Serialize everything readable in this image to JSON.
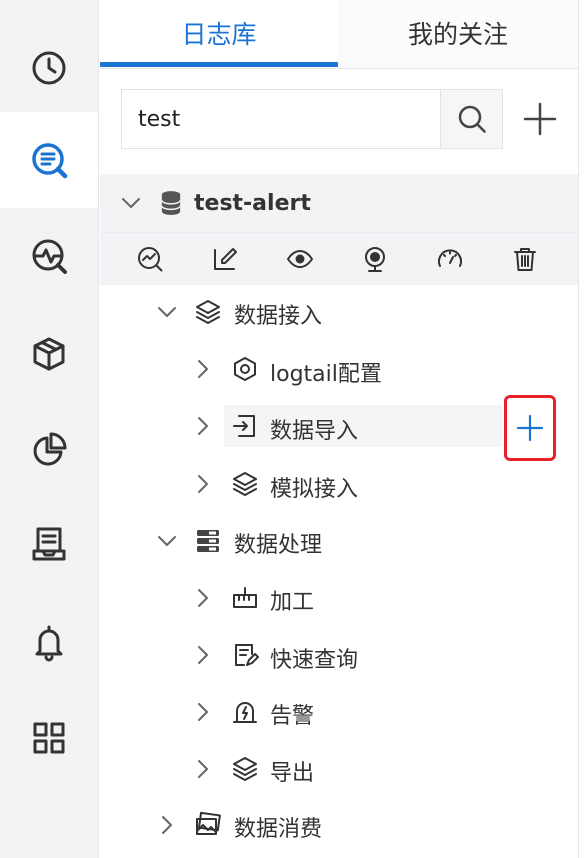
{
  "tabs": [
    {
      "label": "日志库",
      "active": true
    },
    {
      "label": "我的关注",
      "active": false
    }
  ],
  "search": {
    "value": "test"
  },
  "project": {
    "name": "test-alert"
  },
  "toolbar_icons": [
    "dashboard-icon",
    "edit-icon",
    "eye-icon",
    "webcam-icon",
    "gauge-icon",
    "trash-icon"
  ],
  "rail_icons": [
    "clock-icon",
    "log-search-icon",
    "monitor-icon",
    "box-icon",
    "pie-chart-icon",
    "inbox-icon",
    "bell-icon",
    "grid-icon"
  ],
  "tree": {
    "ingest": {
      "label": "数据接入",
      "children": {
        "logtail": "logtail配置",
        "import": "数据导入",
        "mock": "模拟接入"
      }
    },
    "process": {
      "label": "数据处理",
      "children": {
        "transform": "加工",
        "quick_query": "快速查询",
        "alert": "告警",
        "export": "导出"
      }
    },
    "consume": {
      "label": "数据消费"
    }
  },
  "colors": {
    "accent": "#1b74d3",
    "highlight": "#e8202a",
    "rail_bg": "#f2f3f5"
  }
}
